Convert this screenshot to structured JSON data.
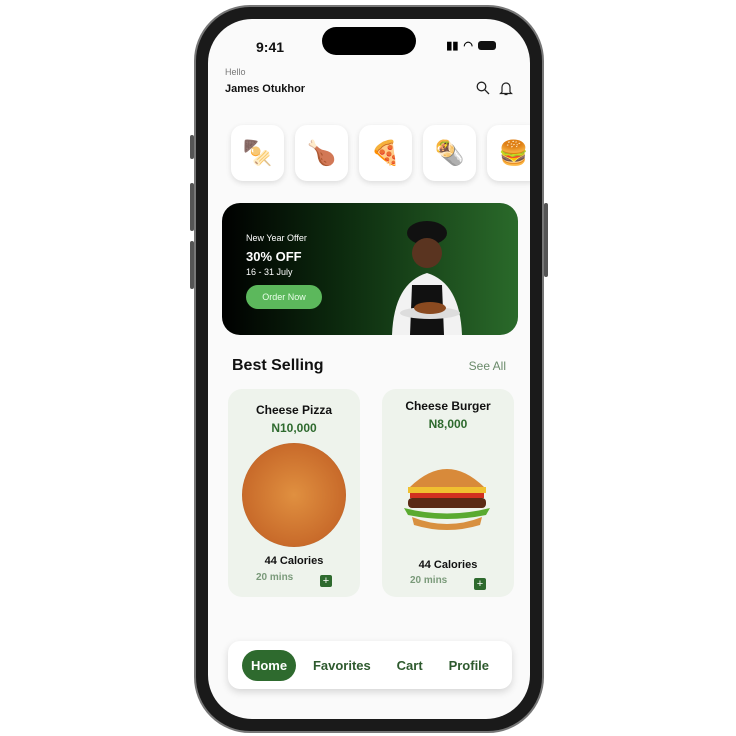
{
  "status": {
    "time": "9:41"
  },
  "header": {
    "greeting": "Hello",
    "user_name": "James Otukhor"
  },
  "categories": [
    {
      "icon": "kebab"
    },
    {
      "icon": "fried-chicken"
    },
    {
      "icon": "pizza"
    },
    {
      "icon": "shawarma"
    },
    {
      "icon": "burger"
    }
  ],
  "banner": {
    "label": "New Year Offer",
    "discount": "30% OFF",
    "dates": "16 - 31 July",
    "cta": "Order Now"
  },
  "best_selling": {
    "title": "Best Selling",
    "see_all": "See All",
    "items": [
      {
        "name": "Cheese Pizza",
        "price": "N10,000",
        "calories": "44 Calories",
        "time": "20 mins"
      },
      {
        "name": "Cheese Burger",
        "price": "N8,000",
        "calories": "44 Calories",
        "time": "20 mins"
      }
    ]
  },
  "nav": {
    "items": [
      "Home",
      "Favorites",
      "Cart",
      "Profile"
    ],
    "active": "Home"
  },
  "colors": {
    "accent": "#2e6a2e",
    "button": "#5cb85c"
  }
}
